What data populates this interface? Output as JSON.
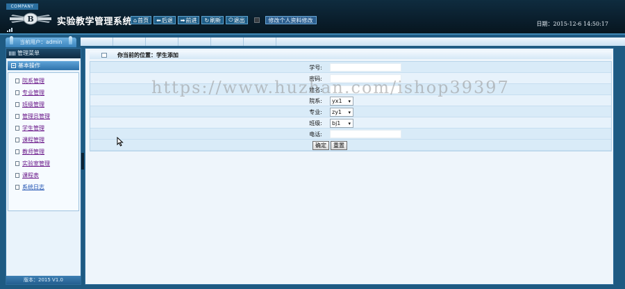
{
  "header": {
    "company": "COMPANY",
    "system_title": "实验教学管理系统",
    "nav": [
      {
        "icon": "home-icon",
        "glyph": "⌂",
        "label": "首页"
      },
      {
        "icon": "back-icon",
        "glyph": "⬅",
        "label": "后退"
      },
      {
        "icon": "forward-icon",
        "glyph": "➡",
        "label": "前进"
      },
      {
        "icon": "refresh-icon",
        "glyph": "↻",
        "label": "刷新"
      },
      {
        "icon": "power-icon",
        "glyph": "⏻",
        "label": "退出"
      }
    ],
    "edit_profile": "修改个人资料修改",
    "datetime": "日期：2015-12-6 14:50:17"
  },
  "user": {
    "current_user": "当前用户：admin"
  },
  "sidebar": {
    "menu_title": "管理菜单",
    "group_title": "基本操作",
    "items": [
      {
        "label": "院系管理"
      },
      {
        "label": "专业管理"
      },
      {
        "label": "班级管理"
      },
      {
        "label": "管理员管理"
      },
      {
        "label": "学生管理"
      },
      {
        "label": "课程管理"
      },
      {
        "label": "教师管理"
      },
      {
        "label": "实验室管理"
      },
      {
        "label": "课程表"
      },
      {
        "label": "系统日志"
      }
    ],
    "version": "版本：2015 V1.0"
  },
  "main": {
    "location": "你当前的位置：学生添加",
    "form": {
      "student_id_label": "学号:",
      "password_label": "密码:",
      "name_label": "姓名:",
      "department_label": "院系:",
      "department_value": "yx1",
      "major_label": "专业:",
      "major_value": "zy1",
      "class_label": "班级:",
      "class_value": "bj1",
      "phone_label": "电话:",
      "confirm": "确定",
      "reset": "重置"
    }
  },
  "watermark": "https://www.huzhan.com/ishop39397"
}
